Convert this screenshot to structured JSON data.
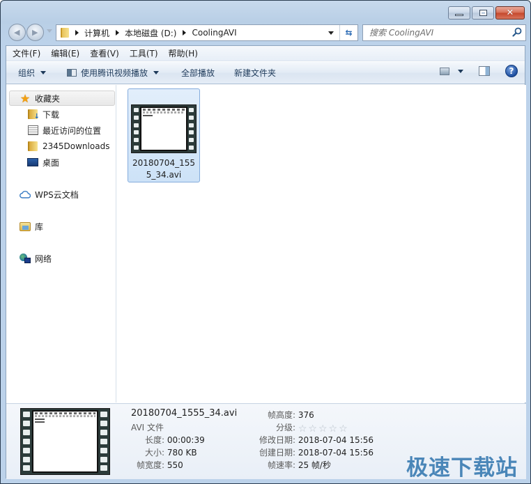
{
  "window": {
    "caption_buttons": {
      "minimize": "minimize",
      "maximize": "maximize",
      "close": "✕"
    }
  },
  "navigation": {
    "back_label": "◀",
    "forward_label": "▶",
    "breadcrumbs": [
      "计算机",
      "本地磁盘 (D:)",
      "CoolingAVI"
    ],
    "refresh_label": "⇆",
    "search_placeholder": "搜索 CoolingAVI"
  },
  "menu_bar": [
    "文件(F)",
    "编辑(E)",
    "查看(V)",
    "工具(T)",
    "帮助(H)"
  ],
  "command_bar": {
    "organize": "组织",
    "play_with": "使用腾讯视频播放",
    "play_all": "全部播放",
    "new_folder": "新建文件夹",
    "help_label": "?"
  },
  "sidebar": {
    "favorites": {
      "label": "收藏夹",
      "items": [
        {
          "label": "下载",
          "icon": "download-folder-icon"
        },
        {
          "label": "最近访问的位置",
          "icon": "recent-places-icon"
        },
        {
          "label": "2345Downloads",
          "icon": "folder-icon"
        },
        {
          "label": "桌面",
          "icon": "desktop-icon"
        }
      ]
    },
    "wps_cloud": "WPS云文档",
    "libraries": "库",
    "network": "网络"
  },
  "files": [
    {
      "name": "20180704_1555_34.avi",
      "selected": true
    }
  ],
  "details": {
    "file_name": "20180704_1555_34.avi",
    "file_type": "AVI 文件",
    "left_fields": [
      {
        "label": "长度:",
        "value": "00:00:39"
      },
      {
        "label": "大小:",
        "value": "780 KB"
      },
      {
        "label": "帧宽度:",
        "value": "550"
      }
    ],
    "right_fields": [
      {
        "label": "帧高度:",
        "value": "376"
      },
      {
        "label": "分级:",
        "value": ""
      },
      {
        "label": "修改日期:",
        "value": "2018-07-04 15:56"
      },
      {
        "label": "创建日期:",
        "value": "2018-07-04 15:56"
      },
      {
        "label": "帧速率:",
        "value": "25 帧/秒"
      }
    ],
    "rating": {
      "stars_filled": 0,
      "stars_total": 5
    }
  },
  "watermark": "极速下载站",
  "colors": {
    "selection_fill": "#cde2f7",
    "selection_border": "#84acdd",
    "close_button": "#c4472b",
    "watermark": "#4a86b8"
  }
}
